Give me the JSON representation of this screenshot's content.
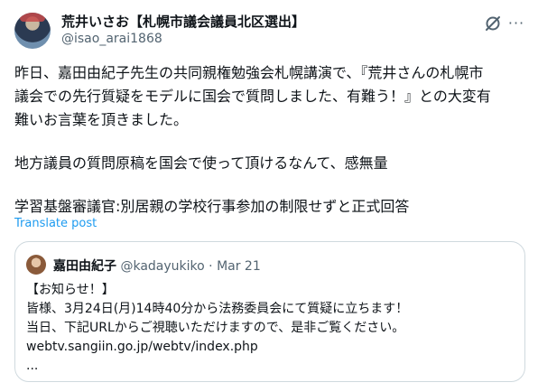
{
  "author": {
    "name": "荒井いさお【札幌市議会議員北区選出】",
    "handle": "@isao_arai1868"
  },
  "icons": {
    "grok": "grok-icon",
    "more": "more-icon"
  },
  "more_glyph": "···",
  "tweet": {
    "lines": [
      "昨日、嘉田由紀子先生の共同親権勉強会札幌講演で、『荒井さんの札幌市",
      "議会での先行質疑をモデルに国会で質問しました、有難う！』との大変有",
      "難いお言葉を頂きました。",
      "",
      "地方議員の質問原稿を国会で使って頂けるなんて、感無量",
      "",
      "学習基盤審議官:別居親の学校行事参加の制限せずと正式回答"
    ],
    "translate_label": "Translate post"
  },
  "quote": {
    "name": "嘉田由紀子",
    "handle": "@kadayukiko",
    "separator": "·",
    "date": "Mar 21",
    "lines": [
      "【お知らせ！】",
      "皆様、3月24日(月)14時40分から法務委員会にて質疑に立ちます！",
      "当日、下記URLからご視聴いただけますので、是非ご覧ください。",
      "webtv.sangiin.go.jp/webtv/index.php",
      "..."
    ]
  },
  "colors": {
    "link": "#1d9bf0",
    "secondary": "#536471",
    "border": "#cfd9de"
  }
}
